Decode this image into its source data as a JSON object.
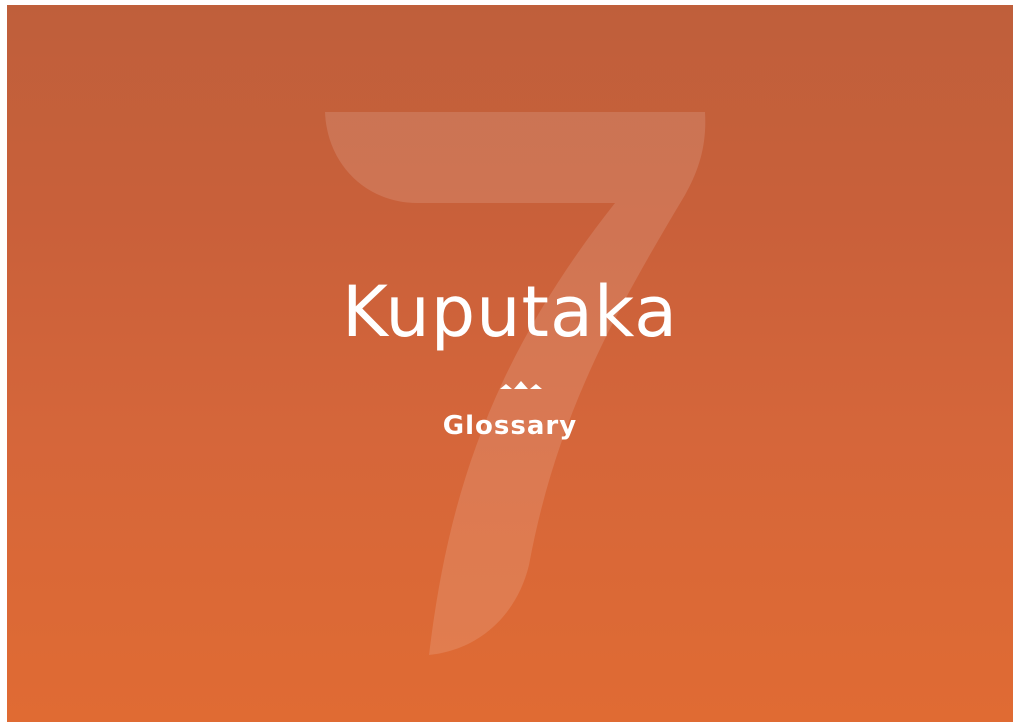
{
  "chapter": {
    "number": "7",
    "title": "Kuputaka",
    "subtitle": "Glossary"
  },
  "colors": {
    "background_top": "#bf5f3b",
    "background_bottom": "#e06b33",
    "numeral": "#ffffff",
    "text": "#ffffff"
  },
  "icons": {
    "divider": "triple-peak-ornament-icon"
  }
}
